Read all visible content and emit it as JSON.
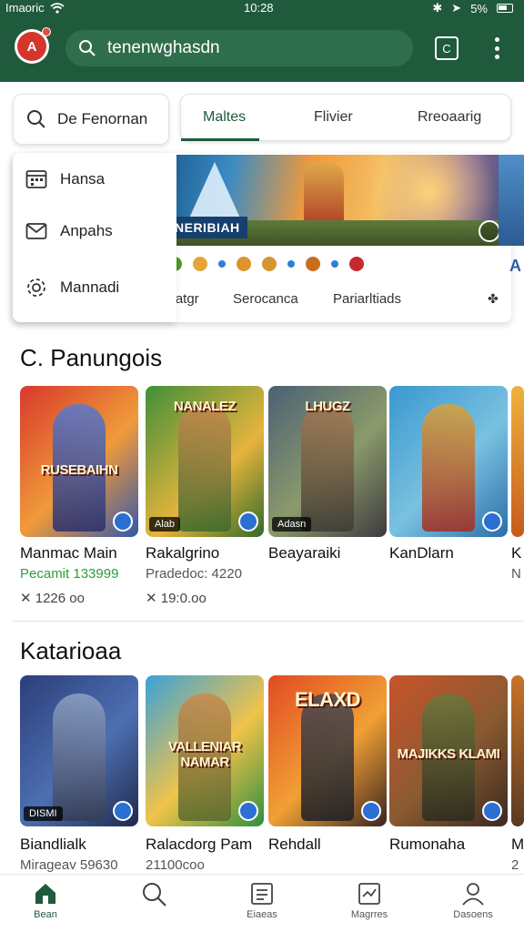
{
  "status_bar": {
    "carrier": "Imaoric",
    "time": "10:28",
    "battery": "5%"
  },
  "header": {
    "search_value": "tenenwghasdn",
    "square_label": "C"
  },
  "filter": {
    "label": "De Fenornan"
  },
  "tabs": [
    {
      "label": "Maltes",
      "active": true
    },
    {
      "label": "Flivier",
      "active": false
    },
    {
      "label": "Rreoaarig",
      "active": false
    }
  ],
  "menu": [
    {
      "label": "Hansa",
      "icon": "calendar-icon"
    },
    {
      "label": "Anpahs",
      "icon": "mail-icon"
    },
    {
      "label": "Mannadi",
      "icon": "gear-icon"
    }
  ],
  "banner": {
    "tag": "NERIBIAH",
    "sub_links": [
      "Natgr",
      "Serocanca",
      "Pariarltiads"
    ],
    "side_letter": "A"
  },
  "sections": [
    {
      "title": "C. Panungois",
      "cards": [
        {
          "art_text": "RUSEBAIHN",
          "title": "Manmac Main",
          "subtitle": "Pecamit 133999",
          "meta": "1226 oo",
          "chip": ""
        },
        {
          "art_text": "NANALEZ",
          "title": "Rakalgrino",
          "subtitle": "Pradedoc: 4220",
          "meta": "19:0.oo",
          "chip": "Alab"
        },
        {
          "art_text": "LHUGZ",
          "title": "Beayaraiki",
          "subtitle": "",
          "meta": "",
          "chip": "Adasn"
        },
        {
          "art_text": "",
          "title": "KanDlarn",
          "subtitle": "",
          "meta": "",
          "chip": ""
        },
        {
          "art_text": "",
          "title": "K",
          "subtitle": "N",
          "meta": "",
          "chip": ""
        }
      ]
    },
    {
      "title": "Katarioaa",
      "cards": [
        {
          "art_text": "",
          "title": "Biandlialk",
          "subtitle": "Mirageav 59630",
          "meta": "",
          "chip": "DISMI"
        },
        {
          "art_text": "VALLENIAR NAMAR",
          "title": "Ralacdorg Pam",
          "subtitle": "21100coo",
          "meta": "",
          "chip": ""
        },
        {
          "art_text": "ELAXD",
          "title": "Rehdall",
          "subtitle": "",
          "meta": "",
          "chip": ""
        },
        {
          "art_text": "MAJIKKS KLAMI",
          "title": "Rumonaha",
          "subtitle": "",
          "meta": "",
          "chip": ""
        },
        {
          "art_text": "",
          "title": "M",
          "subtitle": "2",
          "meta": "",
          "chip": ""
        }
      ]
    }
  ],
  "bottom_nav": [
    {
      "label": "Bean",
      "icon": "home-icon",
      "active": true
    },
    {
      "label": "",
      "icon": "search-icon",
      "active": false
    },
    {
      "label": "Eiaeas",
      "icon": "list-icon",
      "active": false
    },
    {
      "label": "Magrres",
      "icon": "chart-icon",
      "active": false
    },
    {
      "label": "Dasoens",
      "icon": "profile-icon",
      "active": false
    }
  ],
  "colors": {
    "header": "#1f5a3c",
    "accent_green": "#2c9c3a",
    "badge_blue": "#2a6fd1"
  }
}
